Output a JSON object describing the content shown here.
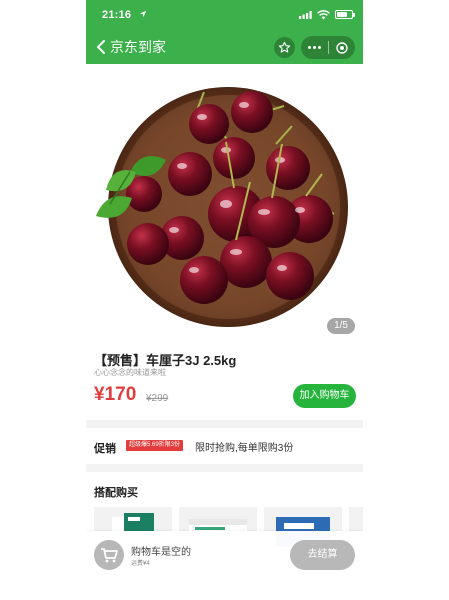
{
  "status_bar": {
    "time": "21:16"
  },
  "nav": {
    "title": "京东到家"
  },
  "gallery": {
    "page_indicator": "1/5"
  },
  "product": {
    "title": "【预售】车厘子3J 2.5kg",
    "subtitle": "心心念念的味道来啦",
    "price": "¥170",
    "original_price": "¥299",
    "add_to_cart": "加入购物车"
  },
  "promotion": {
    "label": "促销",
    "badge": "超级爆5.69折限3份",
    "text": "限时抢购,每单限购3份"
  },
  "combo": {
    "title": "搭配购买"
  },
  "cart_bar": {
    "empty_text": "购物车是空的",
    "delivery_fee": "运费¥4",
    "checkout": "去结算"
  },
  "colors": {
    "brand_green": "#3cb04a",
    "button_green": "#27b43c",
    "price_red": "#e33c3c",
    "disabled_gray": "#b8b8b8"
  },
  "icons": [
    "location-arrow-icon",
    "signal-icon",
    "wifi-icon",
    "battery-icon",
    "back-chevron-icon",
    "star-icon",
    "more-dots-icon",
    "close-circle-icon",
    "shopping-cart-icon"
  ]
}
